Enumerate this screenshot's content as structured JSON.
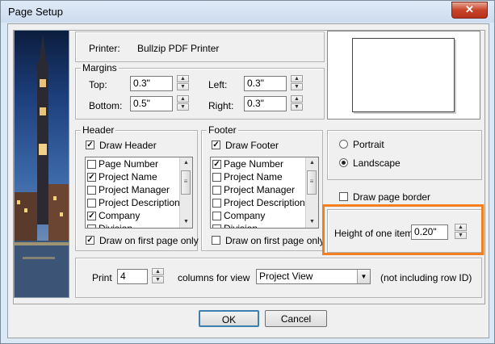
{
  "window": {
    "title": "Page Setup",
    "close_glyph": "✕"
  },
  "printer": {
    "label": "Printer:",
    "value": "Bullzip PDF Printer"
  },
  "margins": {
    "title": "Margins",
    "top_label": "Top:",
    "top_value": "0.3\"",
    "bottom_label": "Bottom:",
    "bottom_value": "0.5\"",
    "left_label": "Left:",
    "left_value": "0.3\"",
    "right_label": "Right:",
    "right_value": "0.3\""
  },
  "header": {
    "title": "Header",
    "draw_label": "Draw Header",
    "draw_checked": true,
    "items": [
      {
        "label": "Page Number",
        "checked": false
      },
      {
        "label": "Project Name",
        "checked": true
      },
      {
        "label": "Project Manager",
        "checked": false
      },
      {
        "label": "Project Description",
        "checked": false
      },
      {
        "label": "Company",
        "checked": true
      },
      {
        "label": "Division",
        "checked": false
      }
    ],
    "first_page_label": "Draw on first page only",
    "first_page_checked": true
  },
  "footer": {
    "title": "Footer",
    "draw_label": "Draw Footer",
    "draw_checked": true,
    "items": [
      {
        "label": "Page Number",
        "checked": true
      },
      {
        "label": "Project Name",
        "checked": false
      },
      {
        "label": "Project Manager",
        "checked": false
      },
      {
        "label": "Project Description",
        "checked": false
      },
      {
        "label": "Company",
        "checked": false
      },
      {
        "label": "Division",
        "checked": false
      }
    ],
    "first_page_label": "Draw on first page only",
    "first_page_checked": false
  },
  "orientation": {
    "portrait_label": "Portrait",
    "landscape_label": "Landscape",
    "selected": "Landscape"
  },
  "border": {
    "label": "Draw page border",
    "checked": false
  },
  "item_height": {
    "label": "Height of one item:",
    "value": "0.20\""
  },
  "print_row": {
    "print_label": "Print",
    "columns_value": "4",
    "columns_label": "columns for view",
    "view_value": "Project View",
    "note": "(not including row ID)"
  },
  "buttons": {
    "ok": "OK",
    "cancel": "Cancel"
  },
  "icons": {
    "spin_up": "▲",
    "spin_down": "▼",
    "dropdown": "▼",
    "check": "✓",
    "scroll_up": "▲",
    "scroll_down": "▼",
    "scroll_grip": "≡"
  },
  "colors": {
    "highlight": "#f47f20",
    "title_bar": "#dbe8f6",
    "close_button": "#c8432a"
  }
}
